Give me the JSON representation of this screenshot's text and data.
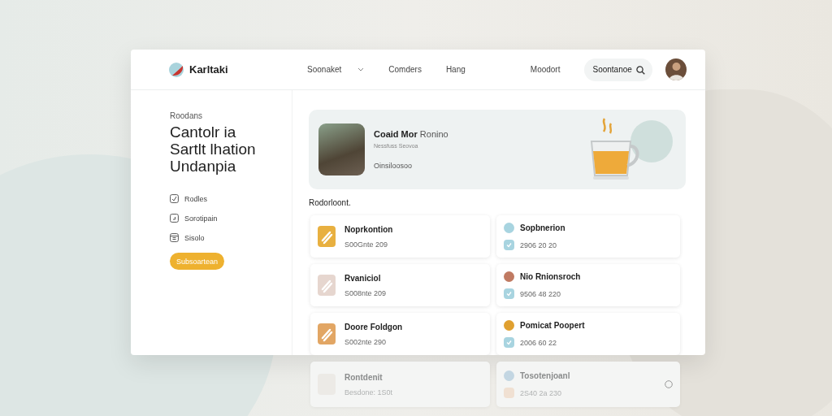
{
  "header": {
    "brand": "Karltaki",
    "nav": [
      {
        "label": "Soonaket"
      },
      {
        "label": "Comders"
      },
      {
        "label": "Hang"
      },
      {
        "label": "Moodort"
      }
    ],
    "search": {
      "placeholder": "Soontanoe"
    }
  },
  "sidebar": {
    "eyebrow": "Roodans",
    "heading": [
      "Cantolr ia",
      "Sartlt lhation",
      "Undanpia"
    ],
    "items": [
      {
        "label": "Rodles"
      },
      {
        "label": "Sorotipain"
      },
      {
        "label": "Sisolo"
      }
    ],
    "button": "Subsoartean"
  },
  "hero": {
    "title": "Coaid Mor",
    "title_light": "Ronino",
    "subtitle": "Nessfuss Seovoa",
    "meta": "Oinsiloosoo"
  },
  "section_title": "Rodorloont.",
  "cards": [
    {
      "kind": "tile",
      "title": "Noprkontion",
      "subtitle": "S00Gnte 209",
      "color": "#e8b040"
    },
    {
      "kind": "dots",
      "title": "Sopbnerion",
      "subtitle": "2906 20 20",
      "color": "#a8d4e0"
    },
    {
      "kind": "tile",
      "title": "Rvaniciol",
      "subtitle": "S008nte 209",
      "color": "#e6d6cf"
    },
    {
      "kind": "dots",
      "title": "Nio Rnionsroch",
      "subtitle": "9506 48 220",
      "color": "#c07a62"
    },
    {
      "kind": "tile",
      "title": "Doore Foldgon",
      "subtitle": "S002nte 290",
      "color": "#e2a664"
    },
    {
      "kind": "dots",
      "title": "Pomicat Poopert",
      "subtitle": "2006 60 22",
      "color": "#e0a030"
    }
  ],
  "reflection_cards": [
    {
      "kind": "tile",
      "title": "Rontdenit",
      "subtitle": "Besdone: 1S0t",
      "color": "#eceae6"
    },
    {
      "kind": "dots",
      "title": "Tosotenjoanl",
      "subtitle": "2S40 2a 230",
      "color": "#c3d6e2"
    }
  ]
}
